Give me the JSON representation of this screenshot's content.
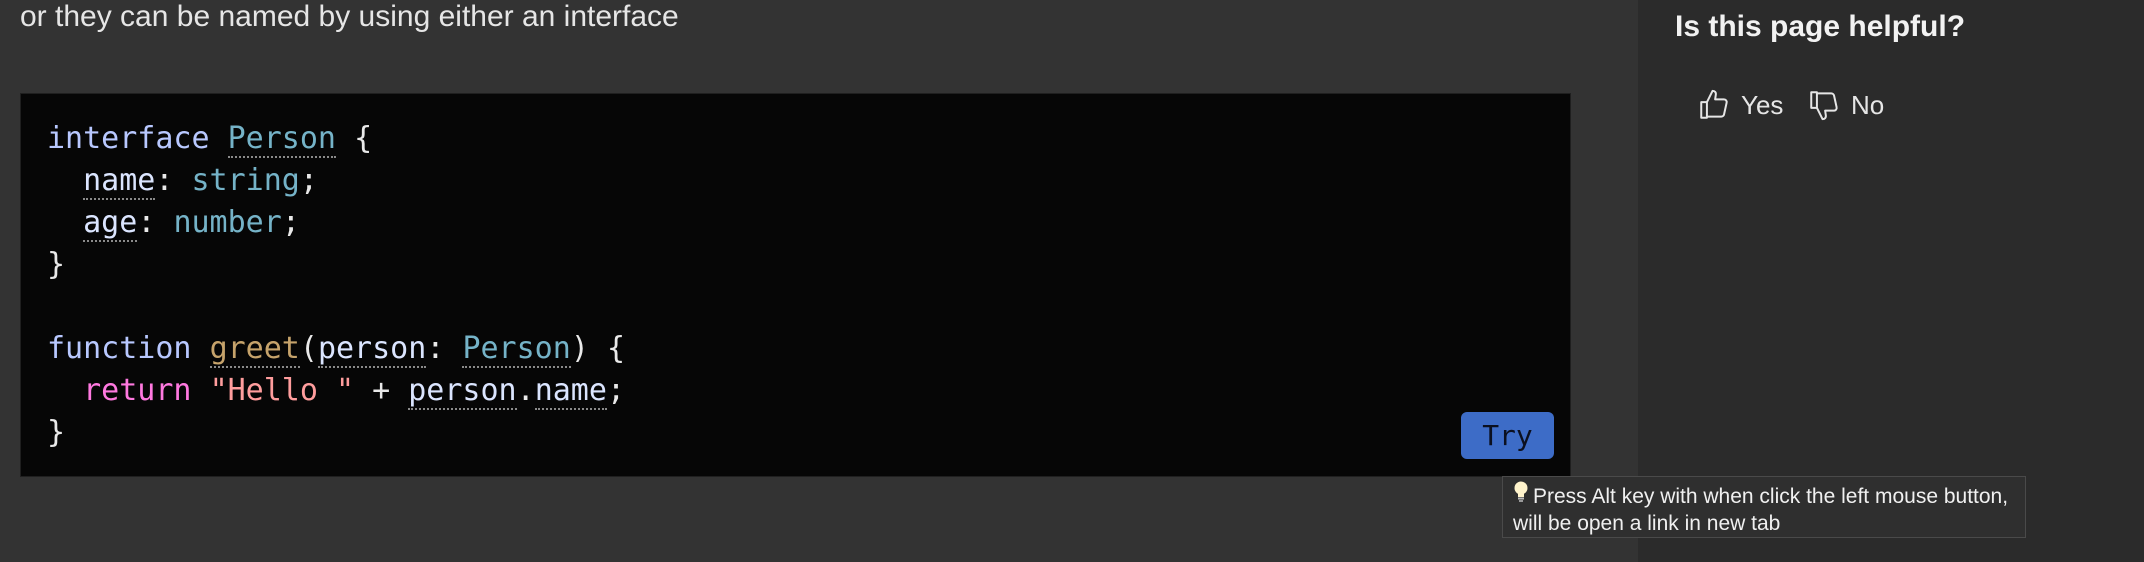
{
  "intro_text": "or they can be named by using either an interface",
  "code": {
    "line1": {
      "kw": "interface",
      "name": "Person",
      "brace": "{"
    },
    "line2": {
      "prop": "name",
      "type": "string"
    },
    "line3": {
      "prop": "age",
      "type": "number"
    },
    "line4": "}",
    "line6": {
      "kw": "function",
      "fn": "greet",
      "param": "person",
      "type": "Person",
      "brace": "{"
    },
    "line7": {
      "kw": "return",
      "str": "\"Hello \"",
      "op": "+",
      "obj": "person",
      "prop": "name"
    },
    "line8": "}"
  },
  "try_label": "Try",
  "tooltip_text": "Press Alt key with when click the left mouse button, will be open a link in new tab",
  "tooltip_icon": "lightbulb-icon",
  "feedback": {
    "title": "Is this page helpful?",
    "yes_label": "Yes",
    "no_label": "No"
  },
  "colors": {
    "background": "#333333",
    "code_background": "#060606",
    "try_button": "#3d6cc7",
    "type": "#75b3c8",
    "function": "#c6a36b",
    "string": "#ff9d9d",
    "keyword_return": "#ff79e0"
  }
}
